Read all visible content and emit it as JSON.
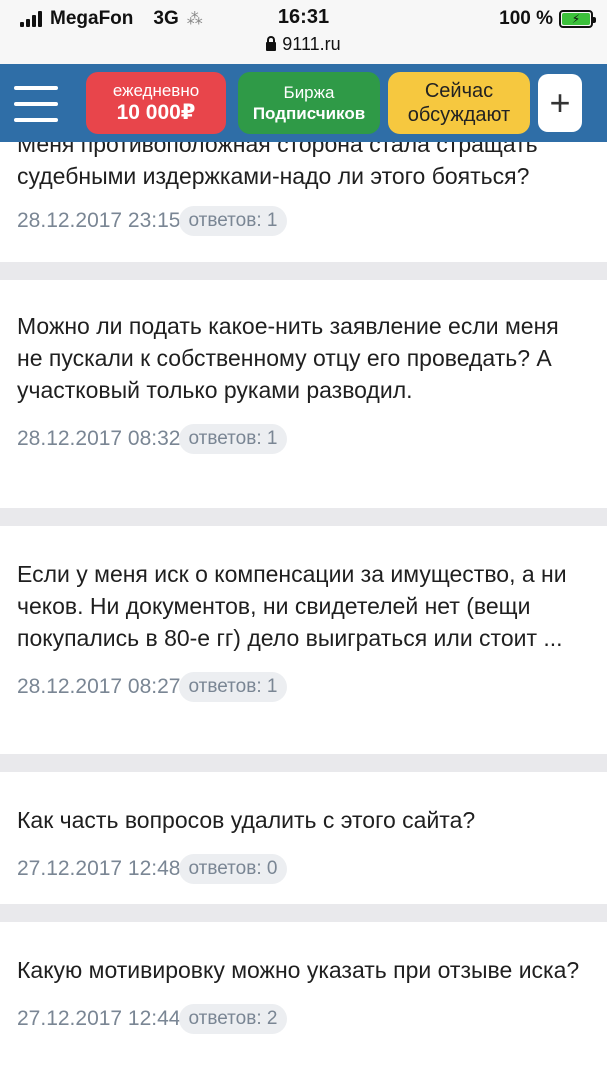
{
  "status": {
    "carrier": "MegaFon",
    "network": "3G",
    "spinner": "⁂",
    "time": "16:31",
    "battery": "100 %",
    "charging_icon": "⚡",
    "url": "9111.ru"
  },
  "nav": {
    "daily_line1": "ежедневно",
    "daily_line2": "10 000₽",
    "birzha_line1": "Биржа",
    "birzha_line2": "Подписчиков",
    "now_line1": "Сейчас",
    "now_line2": "обсуждают",
    "plus": "+"
  },
  "questions": [
    {
      "text": "Меня противоположная сторона стала стращать судебными издержками-надо ли этого бояться?",
      "date": "28.12.2017 23:15",
      "answers": "ответов: 1"
    },
    {
      "text": "Можно ли подать какое-нить заявление если меня не пускали к собственному отцу его проведать? А участковый только руками разводил.",
      "date": "28.12.2017 08:32",
      "answers": "ответов: 1"
    },
    {
      "text": "Если у меня иск о компенсации за имущество, а ни чеков. Ни документов, ни свидетелей нет (вещи покупались в 80-е гг) дело выиграться или стоит ...",
      "date": "28.12.2017 08:27",
      "answers": "ответов: 1"
    },
    {
      "text": "Как часть вопросов удалить с этого сайта?",
      "date": "27.12.2017 12:48",
      "answers": "ответов: 0"
    },
    {
      "text": "Какую мотивировку можно указать при отзыве иска?",
      "date": "27.12.2017 12:44",
      "answers": "ответов: 2"
    }
  ]
}
